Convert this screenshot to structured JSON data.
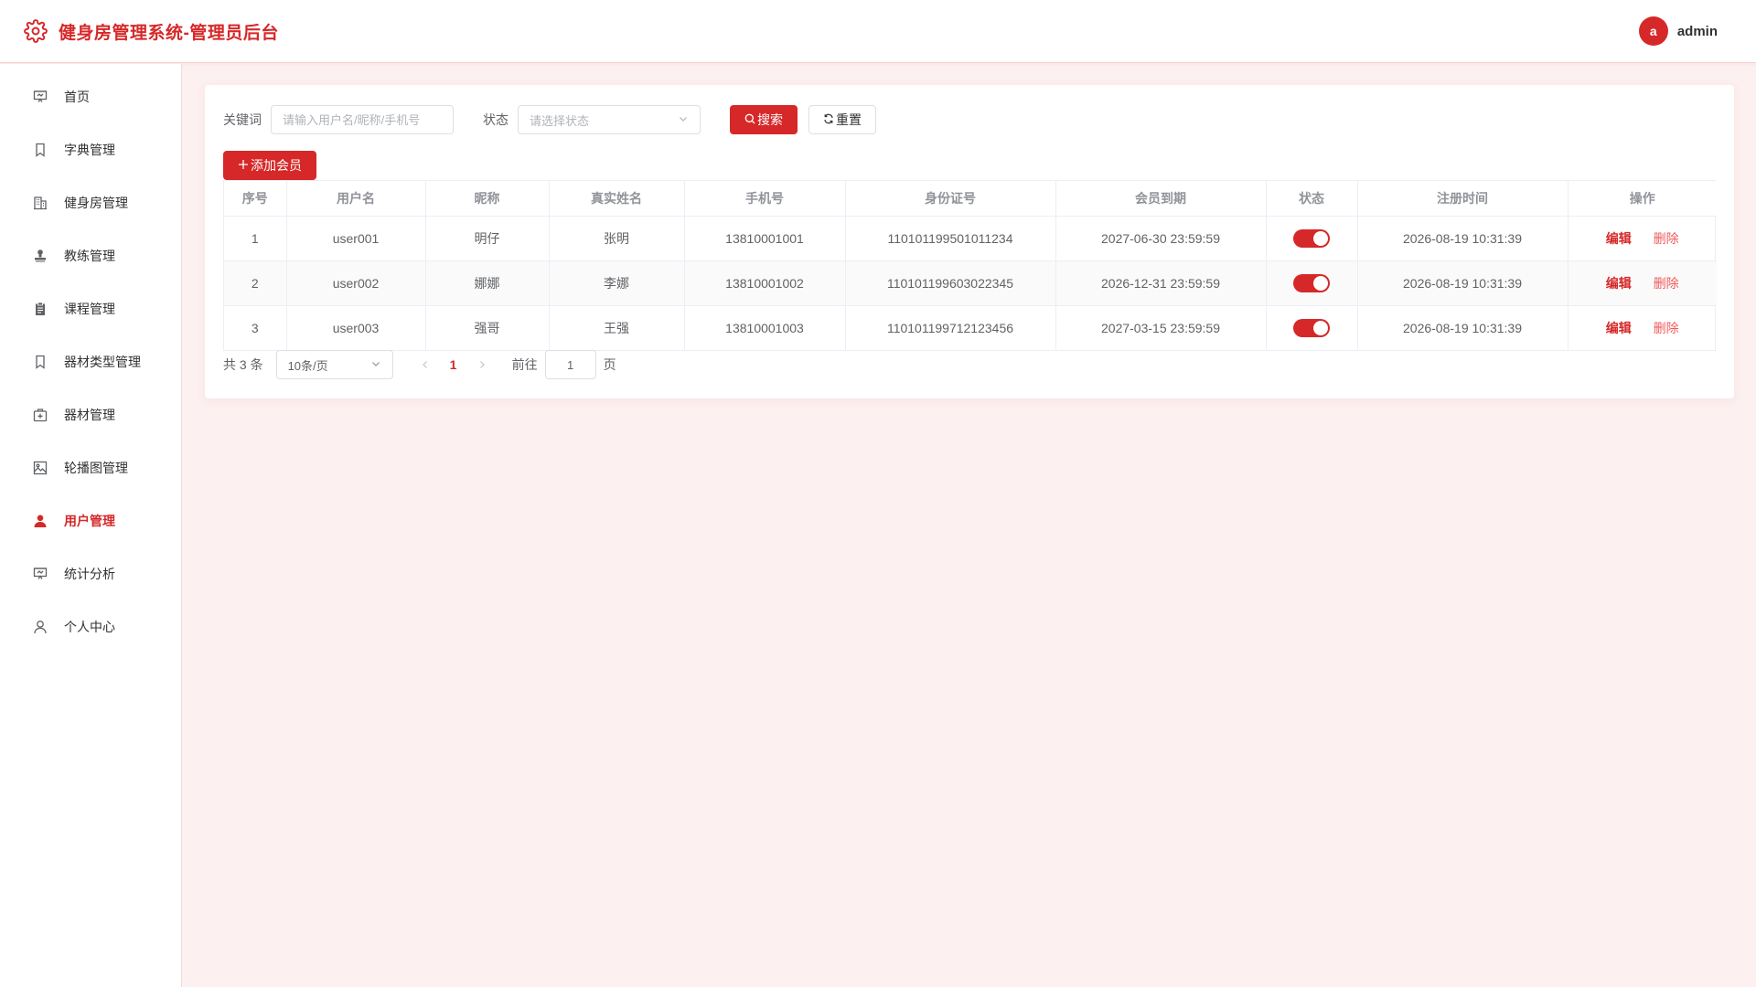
{
  "header": {
    "title": "健身房管理系统-管理员后台",
    "avatar_letter": "a",
    "username": "admin",
    "brand_icon": "gear-icon"
  },
  "sidebar": {
    "items": [
      {
        "label": "首页",
        "icon": "presentation-icon",
        "active": false
      },
      {
        "label": "字典管理",
        "icon": "bookmark-icon",
        "active": false
      },
      {
        "label": "健身房管理",
        "icon": "building-icon",
        "active": false
      },
      {
        "label": "教练管理",
        "icon": "stamp-icon",
        "active": false
      },
      {
        "label": "课程管理",
        "icon": "clipboard-icon",
        "active": false
      },
      {
        "label": "器材类型管理",
        "icon": "bookmark-icon",
        "active": false
      },
      {
        "label": "器材管理",
        "icon": "first-aid-kit-icon",
        "active": false
      },
      {
        "label": "轮播图管理",
        "icon": "picture-icon",
        "active": false
      },
      {
        "label": "用户管理",
        "icon": "user-filled-icon",
        "active": true
      },
      {
        "label": "统计分析",
        "icon": "presentation-icon",
        "active": false
      },
      {
        "label": "个人中心",
        "icon": "user-icon",
        "active": false
      }
    ]
  },
  "filters": {
    "keyword_label": "关键词",
    "keyword_placeholder": "请输入用户名/昵称/手机号",
    "keyword_value": "",
    "status_label": "状态",
    "status_placeholder": "请选择状态",
    "search_label": "搜索",
    "reset_label": "重置"
  },
  "actions": {
    "add_label": "添加会员"
  },
  "table": {
    "columns": [
      "序号",
      "用户名",
      "昵称",
      "真实姓名",
      "手机号",
      "身份证号",
      "会员到期",
      "状态",
      "注册时间",
      "操作"
    ],
    "rows": [
      {
        "index": "1",
        "username": "user001",
        "nickname": "明仔",
        "real_name": "张明",
        "phone": "13810001001",
        "id_card": "110101199501011234",
        "expire": "2027-06-30 23:59:59",
        "status_on": true,
        "registered": "2026-08-19 10:31:39"
      },
      {
        "index": "2",
        "username": "user002",
        "nickname": "娜娜",
        "real_name": "李娜",
        "phone": "13810001002",
        "id_card": "110101199603022345",
        "expire": "2026-12-31 23:59:59",
        "status_on": true,
        "registered": "2026-08-19 10:31:39"
      },
      {
        "index": "3",
        "username": "user003",
        "nickname": "强哥",
        "real_name": "王强",
        "phone": "13810001003",
        "id_card": "110101199712123456",
        "expire": "2027-03-15 23:59:59",
        "status_on": true,
        "registered": "2026-08-19 10:31:39"
      }
    ],
    "edit_label": "编辑",
    "delete_label": "删除"
  },
  "pagination": {
    "total_text": "共 3 条",
    "page_size": "10条/页",
    "current_page": "1",
    "goto_label": "前往",
    "goto_value": "1",
    "page_suffix": "页"
  },
  "colors": {
    "accent": "#d62828",
    "background": "#fdf0f0"
  }
}
